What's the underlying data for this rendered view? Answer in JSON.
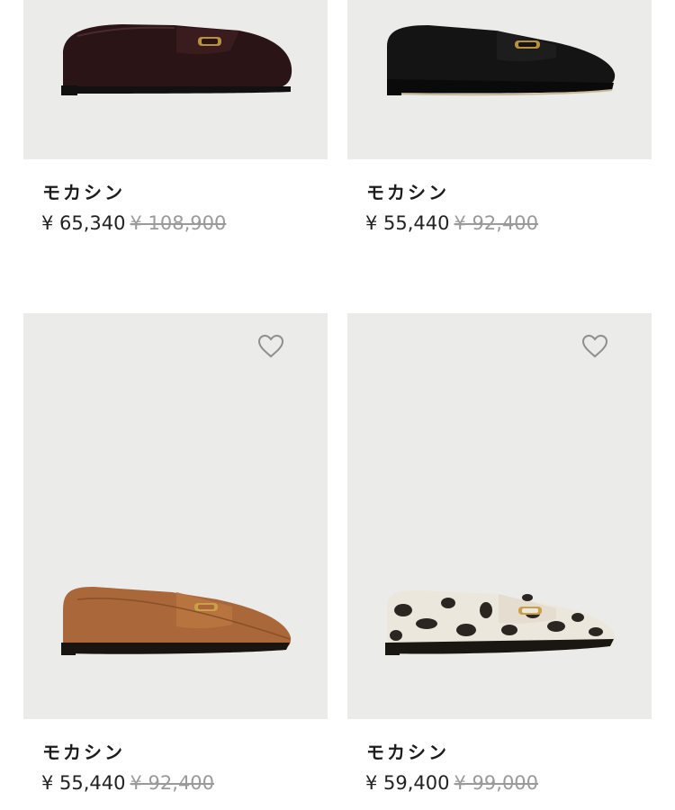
{
  "products": [
    {
      "name": "モカシン",
      "price": "¥ 65,340",
      "original_price": "¥ 108,900",
      "color": "#2b1416",
      "image": "dark-burgundy-leather-loafer"
    },
    {
      "name": "モカシン",
      "price": "¥ 55,440",
      "original_price": "¥ 92,400",
      "color": "#141414",
      "image": "black-suede-loafer"
    },
    {
      "name": "モカシン",
      "price": "¥ 55,440",
      "original_price": "¥ 92,400",
      "color": "#a9673a",
      "image": "tan-leather-loafer",
      "wishlist_icon": "heart-outline-icon"
    },
    {
      "name": "モカシン",
      "price": "¥ 59,400",
      "original_price": "¥ 99,000",
      "color": "#ece7dc",
      "image": "leopard-print-loafer",
      "wishlist_icon": "heart-outline-icon"
    }
  ]
}
